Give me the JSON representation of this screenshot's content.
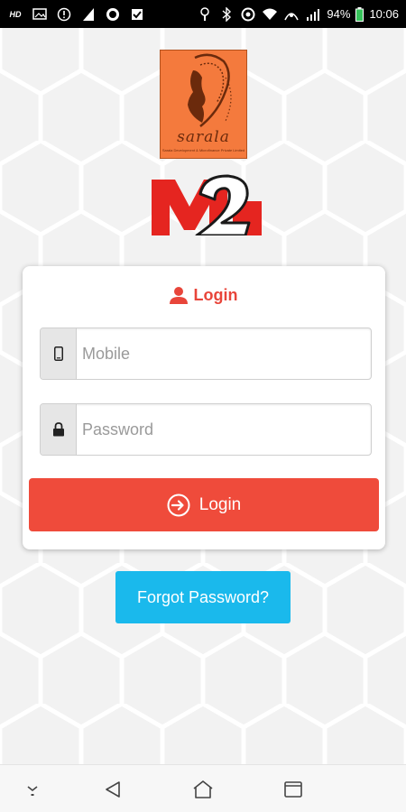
{
  "status_bar": {
    "left_icons": [
      "hd-icon",
      "image-icon",
      "alert-icon",
      "signal-icon",
      "record-icon",
      "check-icon"
    ],
    "right_icons": [
      "flag-icon",
      "bluetooth-icon",
      "data-icon",
      "wifi-icon",
      "lte-icon",
      "cell-signal-icon",
      "battery-icon"
    ],
    "battery": "94%",
    "time": "10:06"
  },
  "logos": {
    "sarala_text": "sarala",
    "sarala_subtitle": "Sarala Development & Microfinance Private Limited",
    "m2_text": "M2"
  },
  "login_card": {
    "title": "Login",
    "mobile": {
      "placeholder": "Mobile",
      "value": ""
    },
    "password": {
      "placeholder": "Password",
      "value": ""
    },
    "login_button": "Login"
  },
  "forgot_password": "Forgot Password?",
  "colors": {
    "accent_red": "#ef4b3b",
    "title_red": "#e8453a",
    "forgot_blue": "#1ab9ec",
    "sarala_orange": "#f47a3d"
  },
  "nav_bar": {
    "items": [
      "down-icon",
      "back-icon",
      "home-icon",
      "recents-icon"
    ]
  }
}
